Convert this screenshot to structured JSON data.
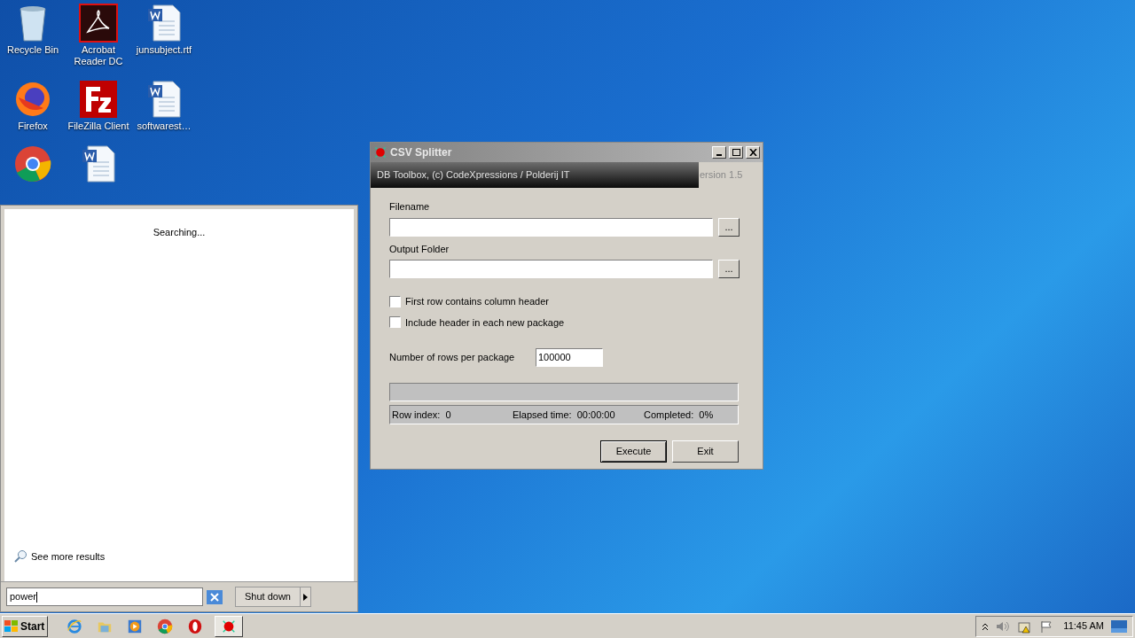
{
  "desktop_icons": [
    {
      "label": "Recycle Bin",
      "kind": "recycle"
    },
    {
      "label": "Acrobat Reader DC",
      "kind": "acrobat"
    },
    {
      "label": "junsubject.rtf",
      "kind": "word"
    },
    {
      "label": "Firefox",
      "kind": "firefox"
    },
    {
      "label": "FileZilla Client",
      "kind": "filezilla"
    },
    {
      "label": "softwarest…",
      "kind": "word"
    },
    {
      "kind": "chrome"
    },
    {
      "kind": "word"
    }
  ],
  "start_menu": {
    "status": "Searching...",
    "see_more": "See more results",
    "search_value": "power",
    "shutdown": "Shut down"
  },
  "window": {
    "title": "CSV Splitter",
    "banner": "DB Toolbox, (c) CodeXpressions / Polderij IT",
    "version": "ersion 1.5",
    "fields": [
      {
        "label": "Filename",
        "browse": "..."
      },
      {
        "label": "Output Folder",
        "browse": "..."
      }
    ],
    "checkboxes": [
      {
        "label": "First row contains column header",
        "checked": false
      },
      {
        "label": "Include header in each new package",
        "checked": false
      }
    ],
    "rows_per_package": {
      "label": "Number of rows per package",
      "value": "100000"
    },
    "progress": {
      "level": 0
    },
    "status": [
      "Row index:  0",
      "Elapsed time:  00:00:00",
      "Completed:  0%"
    ],
    "buttons": [
      {
        "label": "Execute",
        "default": true
      },
      {
        "label": "Exit",
        "default": false
      }
    ]
  },
  "taskbar": {
    "start": "Start",
    "apps": [
      {
        "kind": "ie",
        "selected": false
      },
      {
        "kind": "explorer",
        "selected": false
      },
      {
        "kind": "media",
        "selected": false
      },
      {
        "kind": "chrome",
        "selected": false
      },
      {
        "kind": "opera",
        "selected": false
      },
      {
        "kind": "csv",
        "selected": true
      }
    ],
    "time": "11:45 AM"
  }
}
